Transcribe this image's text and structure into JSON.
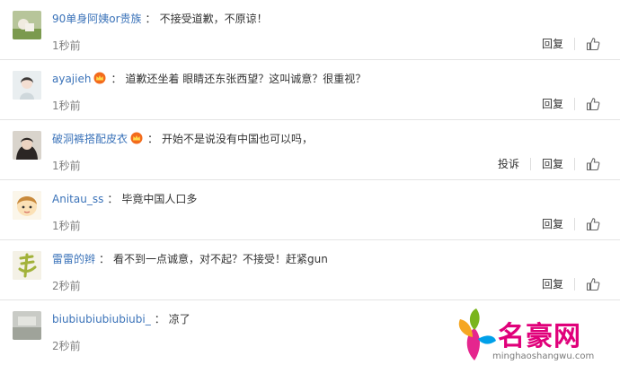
{
  "comments": [
    {
      "user": "90单身阿姨or贵族",
      "vip": false,
      "text": "不接受道歉，不原谅！",
      "time": "1秒前",
      "actions": [
        "回复"
      ]
    },
    {
      "user": "ayajieh",
      "vip": true,
      "text": "道歉还坐着 眼睛还东张西望？这叫诚意？很重视？",
      "time": "1秒前",
      "actions": [
        "回复"
      ]
    },
    {
      "user": "破洞裤搭配皮衣",
      "vip": true,
      "text": "开始不是说没有中国也可以吗，",
      "time": "1秒前",
      "actions": [
        "投诉",
        "回复"
      ]
    },
    {
      "user": "Anitau_ss",
      "vip": false,
      "text": "毕竟中国人口多",
      "time": "1秒前",
      "actions": [
        "回复"
      ]
    },
    {
      "user": "雷雷的辫",
      "vip": false,
      "text": "看不到一点诚意，对不起？不接受！赶紧gun",
      "time": "2秒前",
      "actions": [
        "回复"
      ]
    },
    {
      "user": "biubiubiubiubiubi_",
      "vip": false,
      "text": "凉了",
      "time": "2秒前",
      "actions": []
    }
  ],
  "colon": "：",
  "icons": {
    "like": "thumbs-up-icon",
    "vip": "crown-badge-icon"
  },
  "colors": {
    "username": "#3b73b9",
    "text": "#333333",
    "time": "#808080",
    "divider": "#e4e4e4",
    "watermark": "#e0007a"
  },
  "watermark": {
    "brand": "名豪网",
    "url": "minghaoshangwu.com"
  }
}
